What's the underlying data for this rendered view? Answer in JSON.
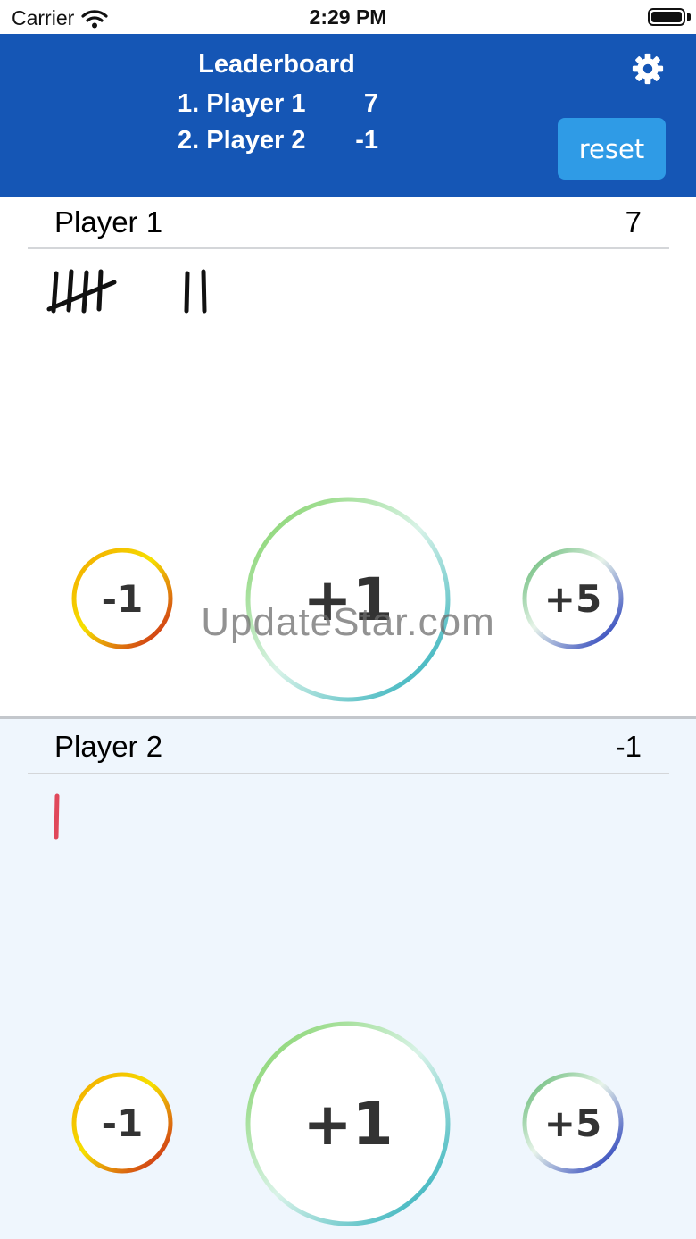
{
  "status_bar": {
    "carrier": "Carrier",
    "time": "2:29 PM"
  },
  "header": {
    "title": "Leaderboard",
    "entries": [
      {
        "rank_name": "1. Player 1",
        "score": "7"
      },
      {
        "rank_name": "2. Player 2",
        "score": "-1"
      }
    ],
    "reset_label": "reset",
    "settings_icon": "gear-icon",
    "bg_color": "#1556b5",
    "reset_color": "#2f9be6"
  },
  "players": [
    {
      "name": "Player 1",
      "score": "7",
      "tally_count": 7,
      "tally_color": "#111111",
      "buttons": {
        "minus": "-1",
        "plus_one": "+1",
        "plus_five": "+5"
      }
    },
    {
      "name": "Player 2",
      "score": "-1",
      "tally_count": 1,
      "tally_color": "#e0485b",
      "buttons": {
        "minus": "-1",
        "plus_one": "+1",
        "plus_five": "+5"
      }
    }
  ],
  "watermark": "UpdateStar.com"
}
